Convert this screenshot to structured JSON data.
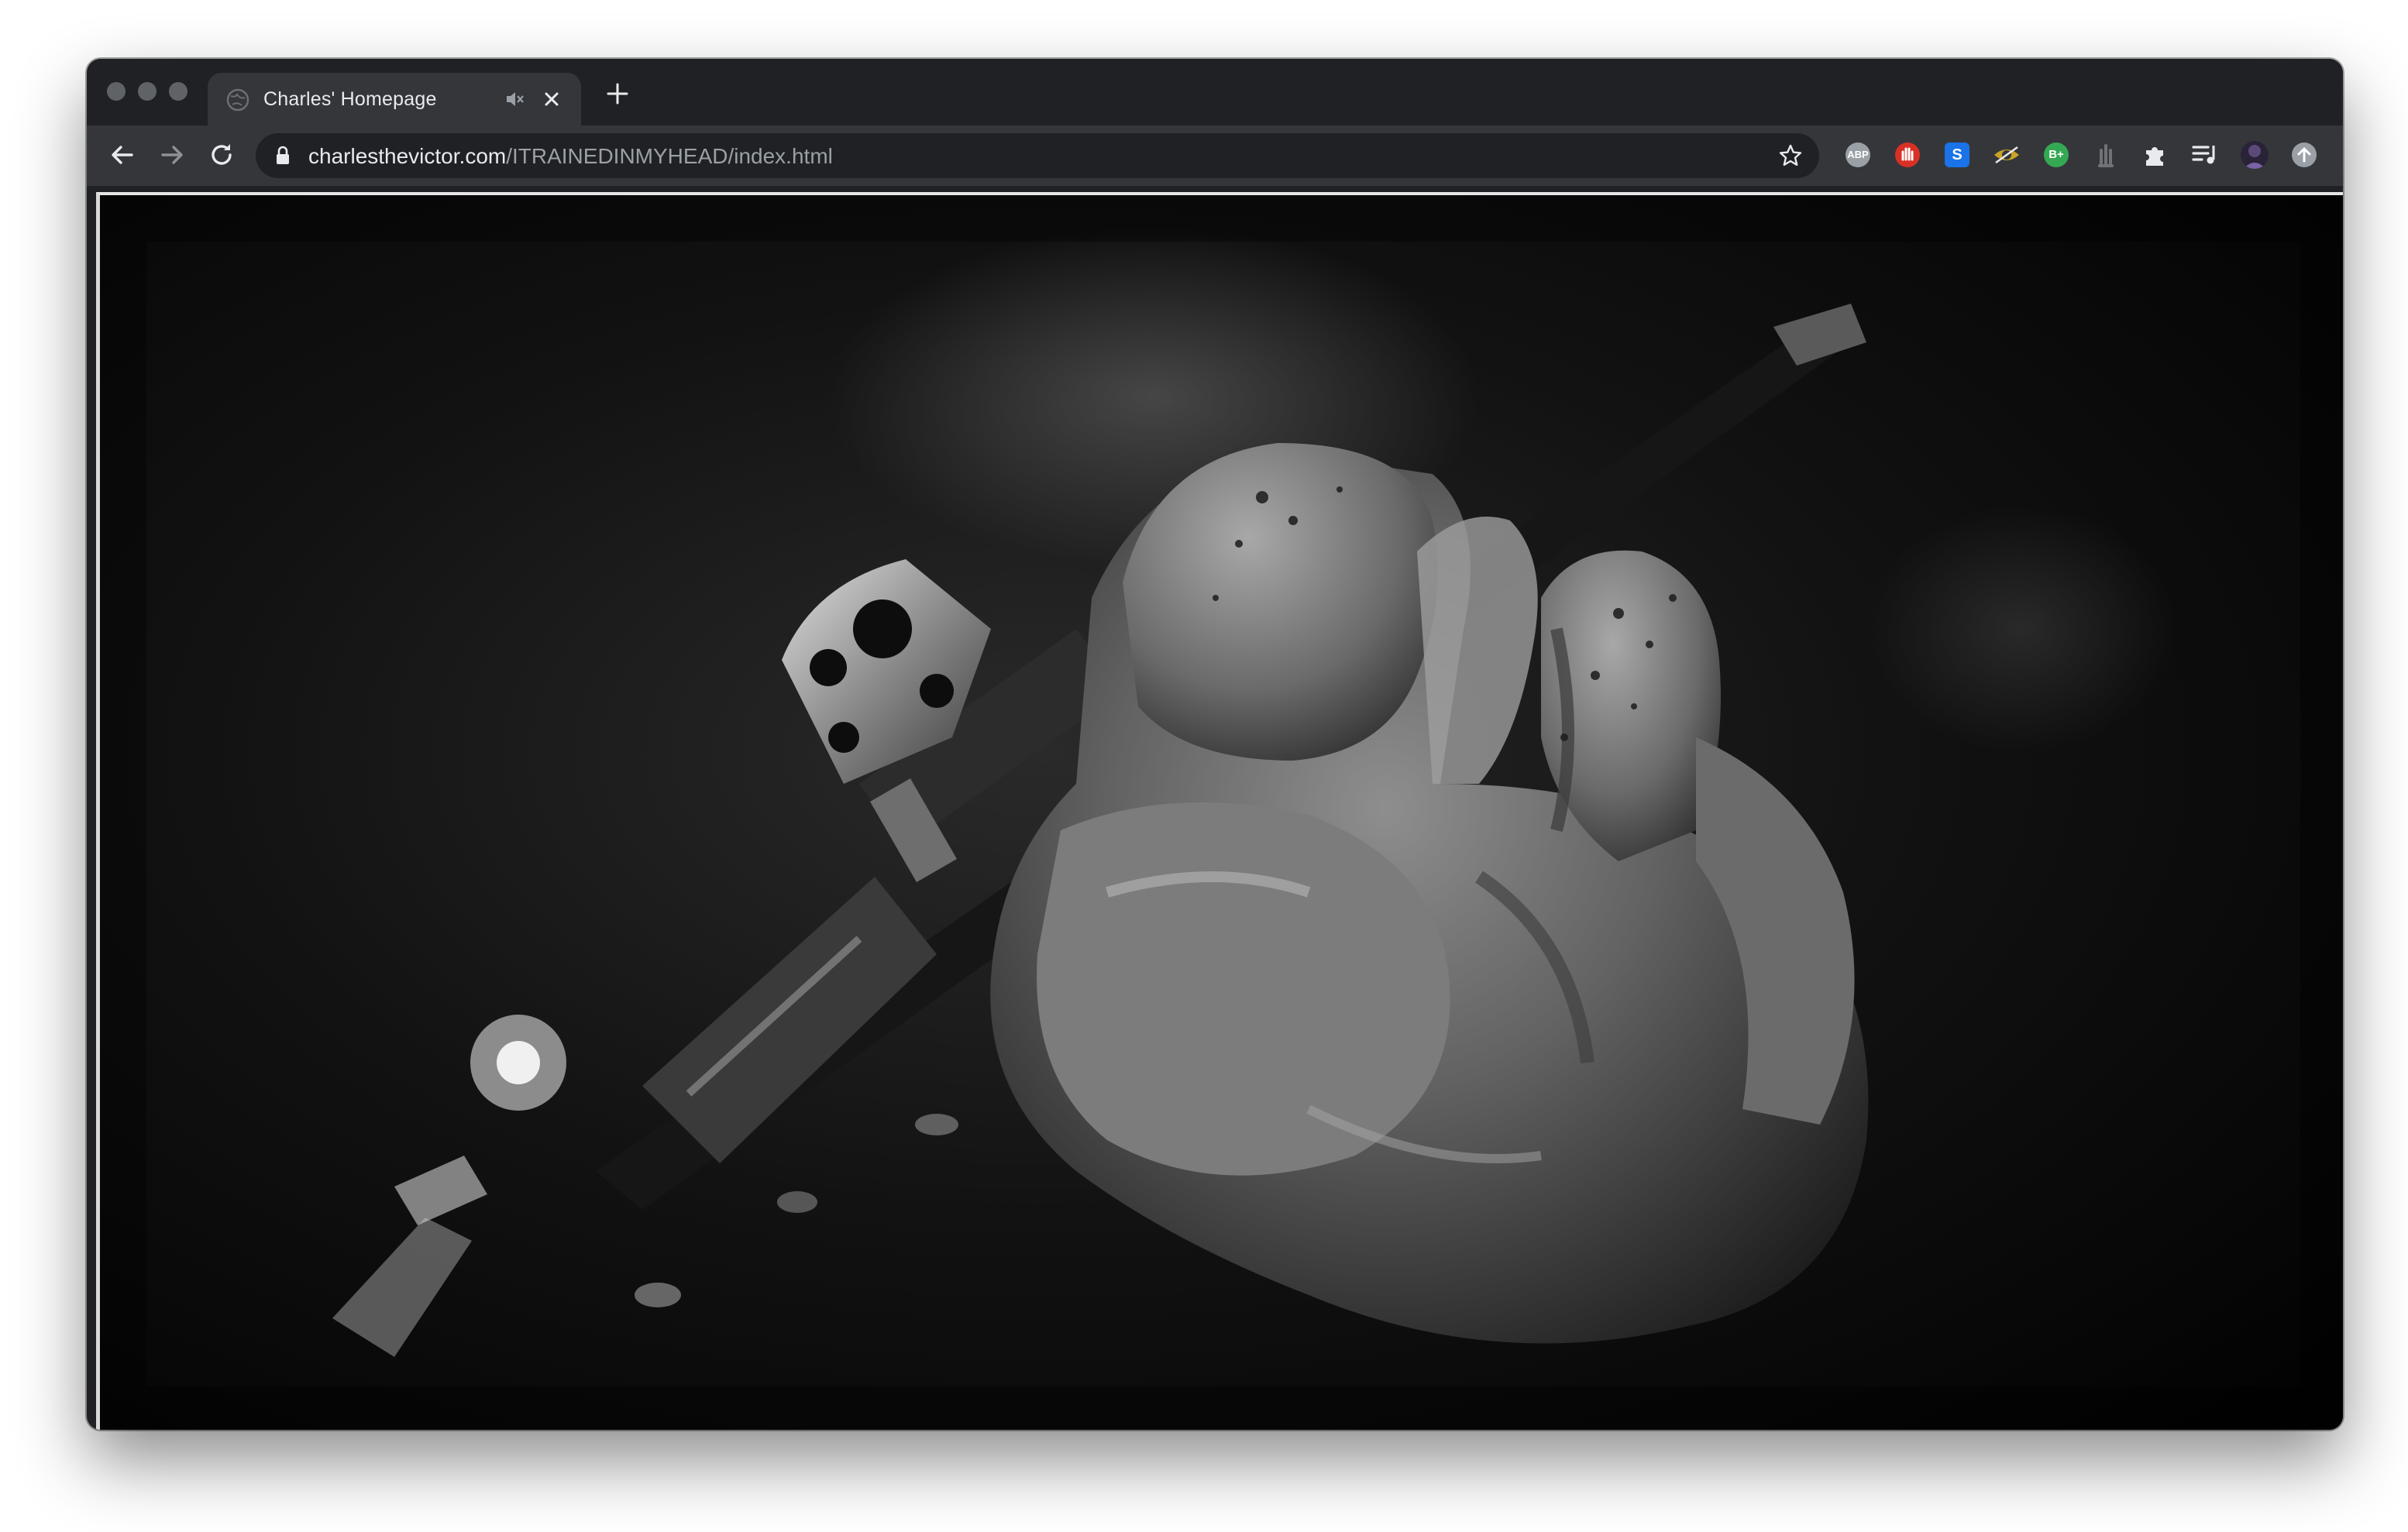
{
  "browser": {
    "tab": {
      "title": "Charles' Homepage",
      "favicon": "globe-icon",
      "audio_icon": "speaker-muted-icon",
      "close_icon": "close-icon"
    },
    "new_tab_icon": "plus-icon",
    "nav": {
      "back_icon": "arrow-left-icon",
      "forward_icon": "arrow-right-icon",
      "reload_icon": "reload-icon"
    },
    "address": {
      "lock_icon": "lock-icon",
      "host": "charlesthevictor.com",
      "path": "/ITRAINEDINMYHEAD/index.html",
      "bookmark_icon": "star-icon"
    },
    "extensions": [
      {
        "name": "adblock-plus",
        "label": "ABP",
        "color": "#9aa0a6"
      },
      {
        "name": "ublock",
        "label": "",
        "color": "#d93025"
      },
      {
        "name": "s-extension",
        "label": "S",
        "color": "#1a73e8"
      },
      {
        "name": "eye-extension",
        "label": "",
        "color": "#c9a227"
      },
      {
        "name": "b-plus-extension",
        "label": "B+",
        "color": "#34a853"
      },
      {
        "name": "hand-extension",
        "label": "",
        "color": "#5f6368"
      }
    ],
    "puzzle_icon": "puzzle-icon",
    "media_icon": "media-queue-icon",
    "avatar": "profile-avatar",
    "update_icon": "update-arrow-icon"
  },
  "page": {
    "image_subject": "black-and-white photo of a gloved hand holding a tattoo machine"
  },
  "colors": {
    "chrome_dark": "#202124",
    "chrome_toolbar": "#35363a",
    "url_text": "#e8eaed",
    "url_path": "#9aa0a6"
  }
}
